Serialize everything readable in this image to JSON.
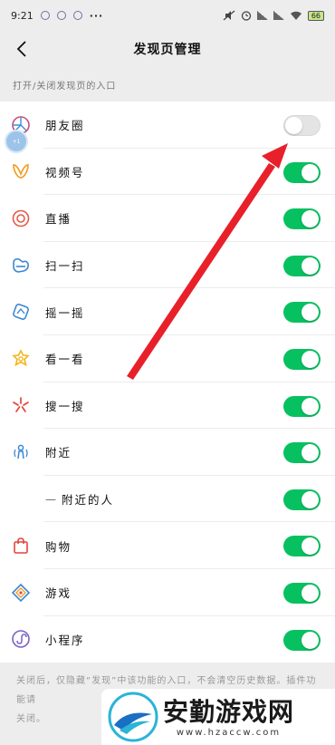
{
  "status": {
    "time": "9:21",
    "more": "···",
    "battery": "66"
  },
  "nav": {
    "title": "发现页管理"
  },
  "section_label": "打开/关闭发现页的入口",
  "items": [
    {
      "label": "朋友圈",
      "icon": "moments-icon",
      "enabled": false
    },
    {
      "label": "视频号",
      "icon": "channels-icon",
      "enabled": true
    },
    {
      "label": "直播",
      "icon": "live-icon",
      "enabled": true
    },
    {
      "label": "扫一扫",
      "icon": "scan-icon",
      "enabled": true
    },
    {
      "label": "摇一摇",
      "icon": "shake-icon",
      "enabled": true
    },
    {
      "label": "看一看",
      "icon": "top-stories-icon",
      "enabled": true
    },
    {
      "label": "搜一搜",
      "icon": "search-icon",
      "enabled": true
    },
    {
      "label": "附近",
      "icon": "nearby-icon",
      "enabled": true
    },
    {
      "label": "附近的人",
      "icon": "",
      "enabled": true,
      "sub": true,
      "prefix": "—"
    },
    {
      "label": "购物",
      "icon": "shopping-icon",
      "enabled": true
    },
    {
      "label": "游戏",
      "icon": "games-icon",
      "enabled": true
    },
    {
      "label": "小程序",
      "icon": "mini-program-icon",
      "enabled": true
    }
  ],
  "footer_note": "关闭后，仅隐藏“发现”中该功能的入口，不会清空历史数据。插件功能请",
  "footer_note_2": "关闭。",
  "float_ball_text": "+1",
  "watermark": {
    "title": "安勤游戏网",
    "url": "www.hzaccw.com"
  },
  "colors": {
    "switch_on": "#07c160",
    "switch_off": "#e4e4e4",
    "arrow": "#e8202a"
  }
}
